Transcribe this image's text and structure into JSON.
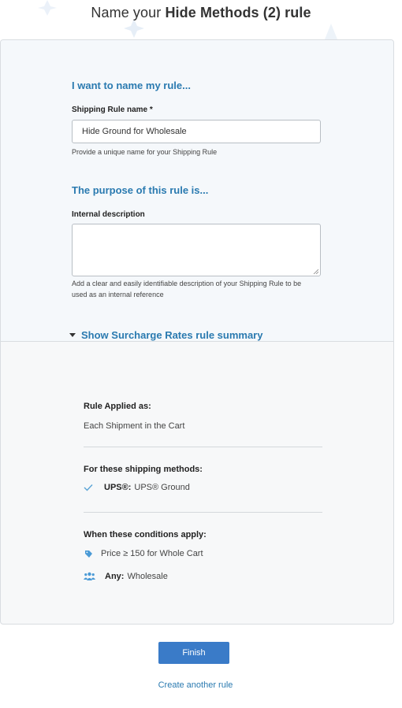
{
  "header": {
    "title_prefix": "Name your",
    "title_strong": "Hide Methods (2) rule"
  },
  "name_section": {
    "heading": "I want to name my rule...",
    "field_label": "Shipping Rule name *",
    "field_value": "Hide Ground for Wholesale",
    "help": "Provide a unique name for your Shipping Rule"
  },
  "purpose_section": {
    "heading": "The purpose of this rule is...",
    "field_label": "Internal description",
    "field_value": "",
    "help": "Add a clear and easily identifiable description of your Shipping Rule to be used as an internal reference"
  },
  "summary": {
    "toggle_label": "Show Surcharge Rates rule summary",
    "applied_label": "Rule Applied as:",
    "applied_value": "Each Shipment in the Cart",
    "methods_label": "For these shipping methods:",
    "method_carrier": "UPS®:",
    "method_name": "UPS® Ground",
    "conditions_label": "When these conditions apply:",
    "condition_price": "Price ≥ 150 for Whole Cart",
    "condition_group_strong": "Any:",
    "condition_group_value": "Wholesale"
  },
  "actions": {
    "finish_label": "Finish",
    "create_another_label": "Create another rule"
  },
  "colors": {
    "accent": "#2a7ab0",
    "button": "#3a7bc8",
    "card_bg": "#f5f8fb"
  },
  "icons": {
    "caret": "caret-down-icon",
    "check": "check-icon",
    "tag": "tag-icon",
    "group": "users-icon"
  }
}
